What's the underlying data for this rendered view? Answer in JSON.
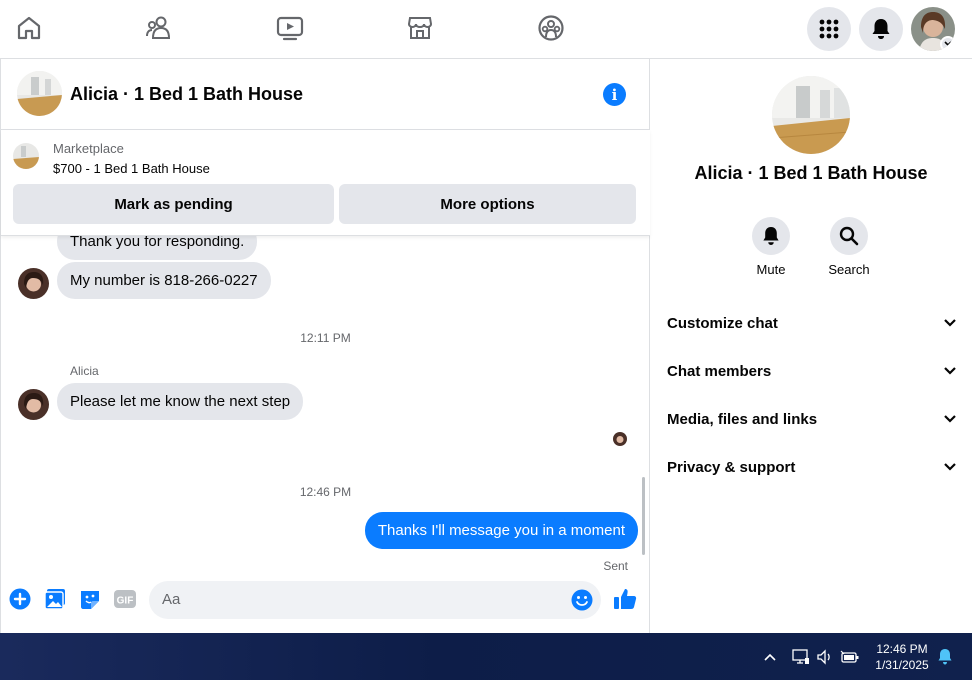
{
  "nav": {
    "icons": [
      "home-icon",
      "friends-icon",
      "watch-icon",
      "marketplace-icon",
      "groups-icon"
    ],
    "right": [
      "menu-grid-icon",
      "notifications-icon",
      "profile-avatar"
    ]
  },
  "chat": {
    "title": "Alicia · 1 Bed 1 Bath House",
    "marketplace": {
      "label": "Marketplace",
      "listing": "$700 - 1 Bed 1 Bath House",
      "mark_pending": "Mark as pending",
      "more_options": "More options"
    },
    "messages": {
      "partial_msg": "Thank you for responding.",
      "msg_number": "My number is 818-266-0227",
      "time1": "12:11 PM",
      "sender": "Alicia",
      "msg_next": "Please let me know the next step",
      "time2": "12:46 PM",
      "msg_out": "Thanks I'll message you in a moment",
      "sent": "Sent"
    },
    "composer": {
      "placeholder": "Aa",
      "gif": "GIF"
    }
  },
  "side": {
    "name": "Alicia · 1 Bed 1 Bath House",
    "mute": "Mute",
    "search": "Search",
    "sections": [
      "Customize chat",
      "Chat members",
      "Media, files and links",
      "Privacy & support"
    ]
  },
  "taskbar": {
    "time": "12:46 PM",
    "date": "1/31/2025"
  },
  "colors": {
    "accent": "#0a7cff",
    "bubble_in": "#e4e6eb",
    "muted_text": "#65676b"
  }
}
